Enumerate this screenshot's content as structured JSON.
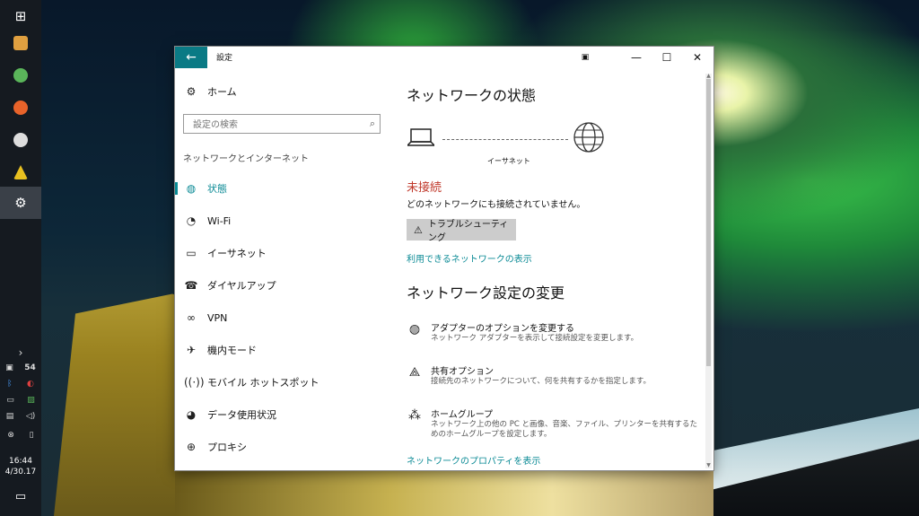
{
  "window": {
    "title": "設定"
  },
  "sidebar": {
    "home": "ホーム",
    "search_placeholder": "設定の検索",
    "section": "ネットワークとインターネット",
    "items": [
      {
        "label": "状態",
        "icon": "globe-status-icon"
      },
      {
        "label": "Wi-Fi",
        "icon": "wifi-icon"
      },
      {
        "label": "イーサネット",
        "icon": "ethernet-icon"
      },
      {
        "label": "ダイヤルアップ",
        "icon": "dialup-icon"
      },
      {
        "label": "VPN",
        "icon": "vpn-icon"
      },
      {
        "label": "機内モード",
        "icon": "airplane-icon"
      },
      {
        "label": "モバイル ホットスポット",
        "icon": "hotspot-icon"
      },
      {
        "label": "データ使用状況",
        "icon": "data-usage-icon"
      },
      {
        "label": "プロキシ",
        "icon": "proxy-icon"
      }
    ]
  },
  "main": {
    "status_title": "ネットワークの状態",
    "connection_label": "イーサネット",
    "status": "未接続",
    "status_desc": "どのネットワークにも接続されていません。",
    "troubleshoot": "トラブルシューティング",
    "available_link": "利用できるネットワークの表示",
    "change_title": "ネットワーク設定の変更",
    "options": [
      {
        "title": "アダプターのオプションを変更する",
        "desc": "ネットワーク アダプターを表示して接続設定を変更します。",
        "icon": "adapter-icon"
      },
      {
        "title": "共有オプション",
        "desc": "接続先のネットワークについて、何を共有するかを指定します。",
        "icon": "sharing-icon"
      },
      {
        "title": "ホームグループ",
        "desc": "ネットワーク上の他の PC と画像、音楽、ファイル、プリンターを共有するためのホームグループを設定します。",
        "icon": "homegroup-icon"
      }
    ],
    "properties_link": "ネットワークのプロパティを表示"
  },
  "taskbar": {
    "time": "16:44",
    "date": "4/30.17",
    "tray_num": "54"
  },
  "colors": {
    "accent": "#0a8a95",
    "error": "#c0392b",
    "titlebar_back": "#0a7a85"
  }
}
